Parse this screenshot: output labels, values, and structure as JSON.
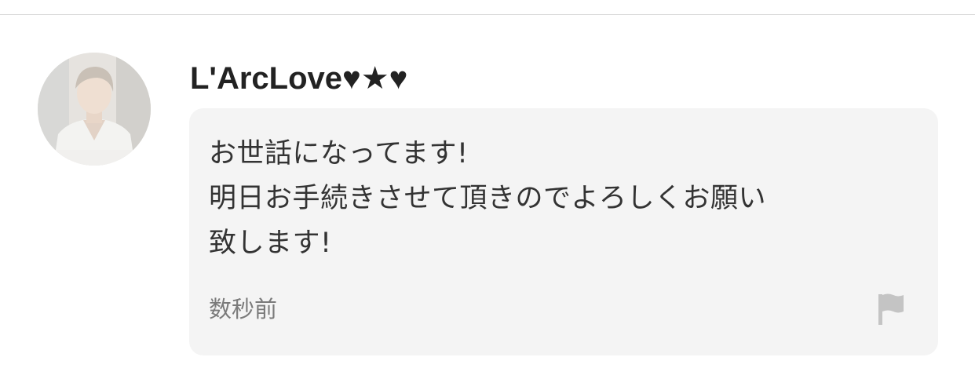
{
  "comment": {
    "author": "L'ArcLove♥★♥",
    "text": "お世話になってます!\n明日お手続きさせて頂きのでよろしくお願い\n致します!",
    "timestamp": "数秒前"
  },
  "icons": {
    "report": "flag-icon",
    "avatar": "user-avatar-photo"
  },
  "colors": {
    "bubble_background": "#f4f4f4",
    "author_text": "#222222",
    "body_text": "#333333",
    "muted_text": "#7a7a7a",
    "flag_icon": "#c4c4c4",
    "divider": "#dcdcdc"
  }
}
